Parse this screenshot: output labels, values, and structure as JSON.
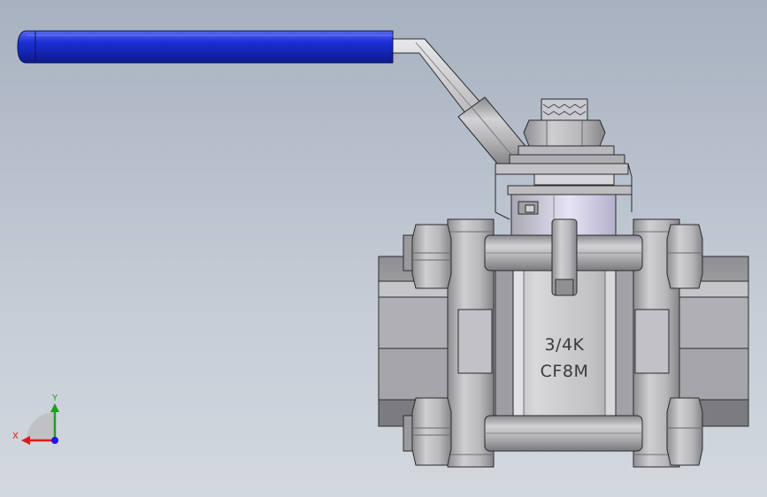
{
  "model": {
    "size_marking": "3/4K",
    "material_marking": "CF8M"
  },
  "triad": {
    "x_label": "X",
    "y_label": "Y"
  },
  "colors": {
    "handle_grip": "#1b2fd6",
    "metal_dark": "#6e6e72",
    "metal_light": "#c9c9cc",
    "axis_x": "#e01a1a",
    "axis_y": "#1aa01a",
    "axis_z": "#1a1ae0"
  },
  "icons": [
    "coordinate-triad-icon"
  ]
}
